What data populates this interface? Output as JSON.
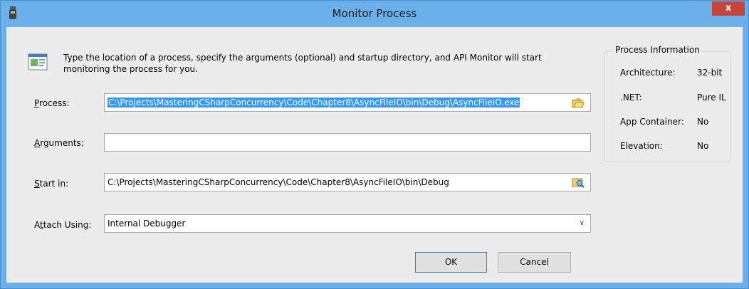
{
  "window": {
    "title": "Monitor Process",
    "close_label": "x"
  },
  "description": "Type the location of a process, specify the arguments (optional) and startup directory, and API Monitor will start monitoring the process for you.",
  "form": {
    "process": {
      "label_accel": "P",
      "label_rest": "rocess:",
      "value": "C:\\Projects\\MasteringCSharpConcurrency\\Code\\Chapter8\\AsyncFileIO\\bin\\Debug\\AsyncFileIO.exe"
    },
    "arguments": {
      "label_accel": "A",
      "label_rest": "rguments:",
      "value": ""
    },
    "start_in": {
      "label_accel": "S",
      "label_rest": "tart in:",
      "value": "C:\\Projects\\MasteringCSharpConcurrency\\Code\\Chapter8\\AsyncFileIO\\bin\\Debug"
    },
    "attach_using": {
      "label_pre": "A",
      "label_accel": "t",
      "label_rest": "tach Using:",
      "value": "Internal Debugger"
    }
  },
  "process_info": {
    "title": "Process Information",
    "rows": [
      {
        "key": "Architecture:",
        "value": "32-bit"
      },
      {
        "key": ".NET:",
        "value": "Pure IL"
      },
      {
        "key": "App Container:",
        "value": "No"
      },
      {
        "key": "Elevation:",
        "value": "No"
      }
    ]
  },
  "buttons": {
    "ok": "OK",
    "cancel": "Cancel"
  },
  "colors": {
    "titlebar": "#6ab0ea",
    "close": "#c7443a",
    "selection": "#3399ff",
    "dialog_bg": "#ececec"
  }
}
